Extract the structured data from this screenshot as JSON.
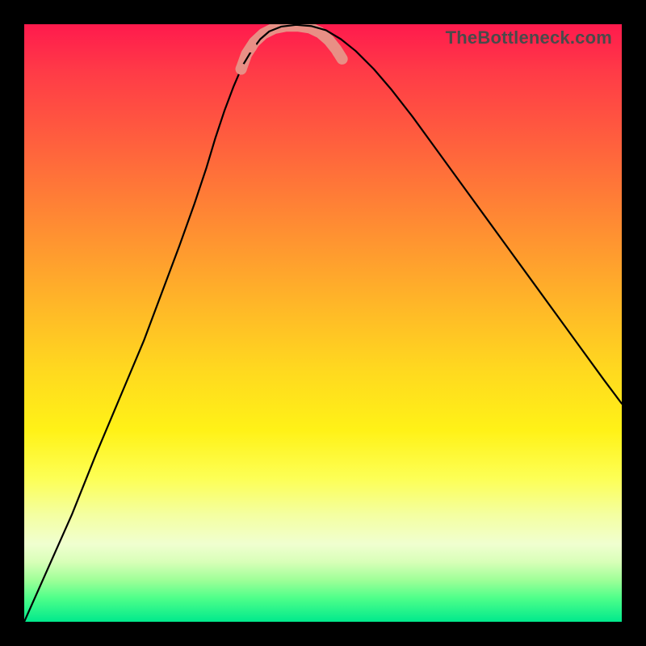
{
  "watermark": "TheBottleneck.com",
  "chart_data": {
    "type": "line",
    "title": "",
    "xlabel": "",
    "ylabel": "",
    "x_range_fraction": [
      0,
      1
    ],
    "y_range_fraction": [
      0,
      1
    ],
    "series": [
      {
        "name": "bottleneck-curve",
        "color": "#000000",
        "stroke_width": 2.2,
        "points_fraction": [
          [
            0.0,
            0.0
          ],
          [
            0.04,
            0.09
          ],
          [
            0.08,
            0.18
          ],
          [
            0.12,
            0.28
          ],
          [
            0.16,
            0.375
          ],
          [
            0.2,
            0.47
          ],
          [
            0.23,
            0.55
          ],
          [
            0.26,
            0.63
          ],
          [
            0.285,
            0.7
          ],
          [
            0.305,
            0.76
          ],
          [
            0.32,
            0.81
          ],
          [
            0.335,
            0.855
          ],
          [
            0.35,
            0.895
          ],
          [
            0.365,
            0.93
          ],
          [
            0.38,
            0.955
          ],
          [
            0.395,
            0.975
          ],
          [
            0.41,
            0.988
          ],
          [
            0.43,
            0.996
          ],
          [
            0.455,
            0.999
          ],
          [
            0.48,
            0.997
          ],
          [
            0.505,
            0.99
          ],
          [
            0.53,
            0.975
          ],
          [
            0.555,
            0.955
          ],
          [
            0.585,
            0.925
          ],
          [
            0.615,
            0.89
          ],
          [
            0.65,
            0.845
          ],
          [
            0.69,
            0.79
          ],
          [
            0.73,
            0.735
          ],
          [
            0.77,
            0.68
          ],
          [
            0.81,
            0.625
          ],
          [
            0.85,
            0.57
          ],
          [
            0.89,
            0.515
          ],
          [
            0.93,
            0.46
          ],
          [
            0.97,
            0.405
          ],
          [
            1.0,
            0.365
          ]
        ]
      },
      {
        "name": "highlight-band",
        "color": "#e88f85",
        "stroke_width": 14,
        "linecap": "round",
        "points_fraction": [
          [
            0.363,
            0.925
          ],
          [
            0.372,
            0.95
          ],
          [
            0.385,
            0.97
          ],
          [
            0.4,
            0.984
          ],
          [
            0.418,
            0.993
          ],
          [
            0.438,
            0.997
          ],
          [
            0.458,
            0.997
          ],
          [
            0.478,
            0.994
          ],
          [
            0.495,
            0.986
          ],
          [
            0.51,
            0.973
          ],
          [
            0.522,
            0.958
          ],
          [
            0.532,
            0.942
          ]
        ]
      }
    ],
    "markers": [
      {
        "name": "marker-left-1",
        "xy_fraction": [
          0.363,
          0.925
        ],
        "color": "#e88f85",
        "r": 7
      },
      {
        "name": "marker-left-2",
        "xy_fraction": [
          0.38,
          0.962
        ],
        "color": "#e88f85",
        "r": 7
      },
      {
        "name": "marker-right-1",
        "xy_fraction": [
          0.51,
          0.973
        ],
        "color": "#e88f85",
        "r": 7
      },
      {
        "name": "marker-right-2",
        "xy_fraction": [
          0.525,
          0.953
        ],
        "color": "#e88f85",
        "r": 7
      }
    ]
  }
}
